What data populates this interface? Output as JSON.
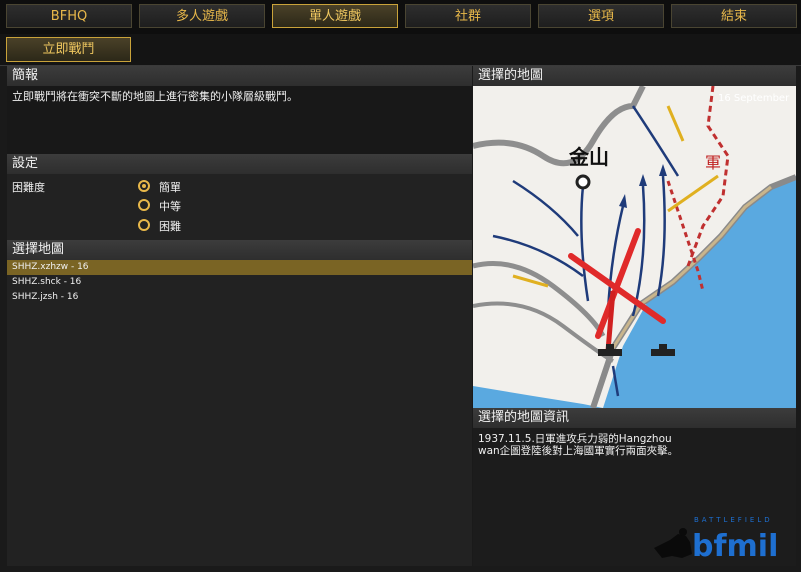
{
  "nav": {
    "items": [
      "BFHQ",
      "多人遊戲",
      "單人遊戲",
      "社群",
      "選項",
      "結束"
    ],
    "active": "單人遊戲"
  },
  "subnav": {
    "instant_battle_label": "立即戰鬥"
  },
  "briefing": {
    "title": "簡報",
    "text": "立即戰鬥將在衝突不斷的地圖上進行密集的小隊層級戰鬥。"
  },
  "settings": {
    "title": "設定",
    "difficulty_label": "困難度",
    "options": [
      "簡單",
      "中等",
      "困難"
    ],
    "selected": "簡單"
  },
  "map_select": {
    "title": "選擇地圖",
    "maps": [
      "SHHZ.xzhzw - 16",
      "SHHZ.shck - 16",
      "SHHZ.jzsh - 16"
    ],
    "selected_index": 0
  },
  "selected_map": {
    "title": "選擇的地圖",
    "city_label": "金山",
    "corner_right": "16 September"
  },
  "map_info": {
    "title": "選擇的地圖資訊",
    "line1": "1937.11.5.日軍進攻兵力弱的Hangzhou",
    "line2": "wan企圖登陸後對上海國軍實行兩面夾擊。"
  },
  "logo": {
    "small_text": "BATTLEFIELD",
    "big_text": "bfmil"
  },
  "colors": {
    "accent": "#e8b84a",
    "selected_row": "#7a6424"
  }
}
